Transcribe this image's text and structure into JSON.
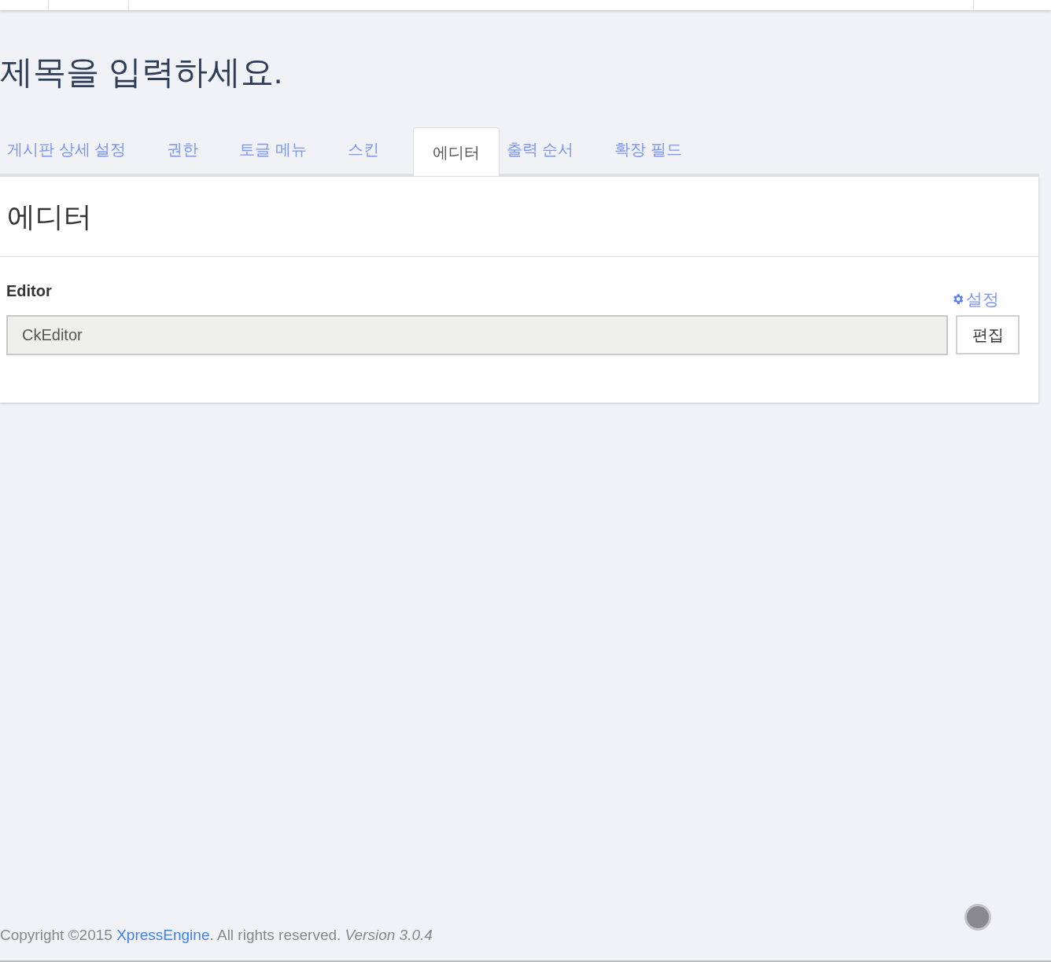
{
  "page_title": "제목을 입력하세요.",
  "tabs": [
    {
      "label": "게시판 상세 설정",
      "selected": false
    },
    {
      "label": "권한",
      "selected": false
    },
    {
      "label": "토글 메뉴",
      "selected": false
    },
    {
      "label": "스킨",
      "selected": false
    },
    {
      "label": "에디터",
      "selected": true
    },
    {
      "label": "출력 순서",
      "selected": false
    },
    {
      "label": "확장 필드",
      "selected": false
    }
  ],
  "panel": {
    "heading": "에디터",
    "field_label": "Editor",
    "settings_link": "설정",
    "editor_value": "CkEditor",
    "edit_button": "편집"
  },
  "footer": {
    "copyright": "Copyright ©2015",
    "link": "XpressEngine",
    "rest": ". All rights reserved.",
    "version": "Version 3.0.4"
  }
}
